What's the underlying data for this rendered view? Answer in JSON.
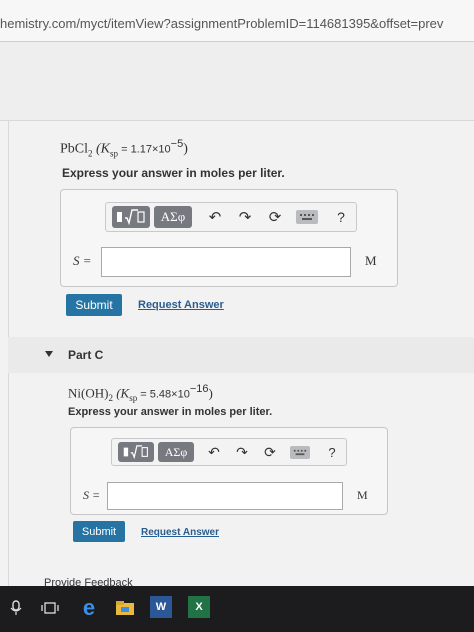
{
  "browser": {
    "url": "hemistry.com/myct/itemView?assignmentProblemID=114681395&offset=prev"
  },
  "partB": {
    "formula": {
      "compound": "PbCl",
      "compound_sub": "2",
      "k_open": "(K",
      "k_sub": "sp",
      "k_eq": " = 1.17×10",
      "k_exp": "−5",
      "k_close": ")"
    },
    "instruction": "Express your answer in moles per liter.",
    "toolbar": {
      "greek_label": "ΑΣφ",
      "help_label": "?"
    },
    "variable_label": "S =",
    "input_value": "",
    "unit": "M",
    "submit_label": "Submit",
    "request_label": "Request Answer"
  },
  "partC": {
    "title": "Part C",
    "formula": {
      "compound": "Ni(OH)",
      "compound_sub": "2",
      "k_open": "(K",
      "k_sub": "sp",
      "k_eq": " = 5.48×10",
      "k_exp": "−16",
      "k_close": ")"
    },
    "instruction": "Express your answer in moles per liter.",
    "toolbar": {
      "greek_label": "ΑΣφ",
      "help_label": "?"
    },
    "variable_label": "S =",
    "input_value": "",
    "unit": "M",
    "submit_label": "Submit",
    "request_label": "Request Answer"
  },
  "footer": {
    "feedback_label": "Provide Feedback"
  },
  "taskbar": {
    "icons": [
      "search-icon",
      "task-view-icon",
      "edge-icon",
      "file-explorer-icon",
      "word-icon",
      "excel-icon"
    ],
    "word_letter": "W",
    "excel_letter": "X"
  }
}
